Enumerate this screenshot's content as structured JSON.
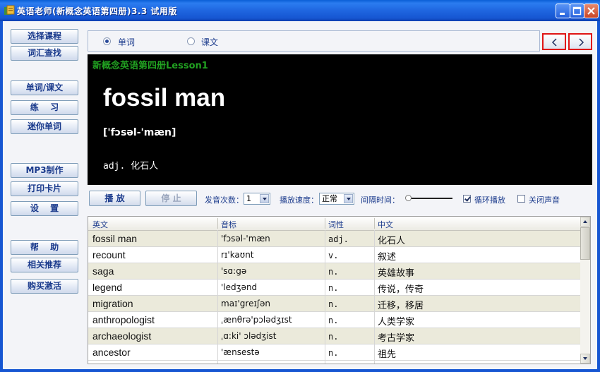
{
  "window": {
    "title": "英语老师(新概念英语第四册)3.3 试用版",
    "controls": [
      "minimize-icon",
      "maximize-icon",
      "close-icon"
    ]
  },
  "sidebar": {
    "items": [
      {
        "label": "选择课程"
      },
      {
        "label": "词汇查找"
      },
      {
        "label": "单词/课文"
      },
      {
        "label": "练　 习"
      },
      {
        "label": "迷你单词"
      },
      {
        "label": "MP3制作"
      },
      {
        "label": "打印卡片"
      },
      {
        "label": "设　 置"
      },
      {
        "label": "帮　 助"
      },
      {
        "label": "相关推荐"
      },
      {
        "label": "购买激活"
      }
    ]
  },
  "mode": {
    "word_label": "单词",
    "text_label": "课文",
    "selected": "单词"
  },
  "nav": {
    "prev_icon": "chevron-left-icon",
    "next_icon": "chevron-right-icon"
  },
  "display": {
    "lesson_title": "新概念英语第四册Lesson1",
    "word": "fossil man",
    "phonetic": "['fɔsəl-'mæn]",
    "meaning": "adj. 化石人"
  },
  "controls": {
    "play_label": "播 放",
    "stop_label": "停 止",
    "repeat_label": "发音次数：",
    "repeat_value": "1",
    "speed_label": "播放速度：",
    "speed_value": "正常",
    "interval_label": "间隔时间：",
    "loop_label": "循环播放",
    "loop_checked": true,
    "mute_label": "关闭声音",
    "mute_checked": false
  },
  "table": {
    "headers": {
      "en": "英文",
      "ph": "音标",
      "pos": "词性",
      "cn": "中文"
    },
    "rows": [
      {
        "en": "fossil man",
        "ph": "'fɔsəl-'mæn",
        "pos": "adj.",
        "cn": "化石人"
      },
      {
        "en": "recount",
        "ph": "rɪ'kaʊnt",
        "pos": "v.",
        "cn": "叙述"
      },
      {
        "en": "saga",
        "ph": "'sɑ:gə",
        "pos": "n.",
        "cn": "英雄故事"
      },
      {
        "en": "legend",
        "ph": "'ledʒənd",
        "pos": "n.",
        "cn": "传说，传奇"
      },
      {
        "en": "migration",
        "ph": "maɪ'greɪʃən",
        "pos": "n.",
        "cn": "迁移，移居"
      },
      {
        "en": "anthropologist",
        "ph": "ˌænθrə'pɔlədʒɪst",
        "pos": "n.",
        "cn": "人类学家"
      },
      {
        "en": "archaeologist",
        "ph": "ˌɑ:ki' ɔlədʒist",
        "pos": "n.",
        "cn": "考古学家"
      },
      {
        "en": "ancestor",
        "ph": "'ænsestə",
        "pos": "n.",
        "cn": "祖先"
      }
    ]
  }
}
